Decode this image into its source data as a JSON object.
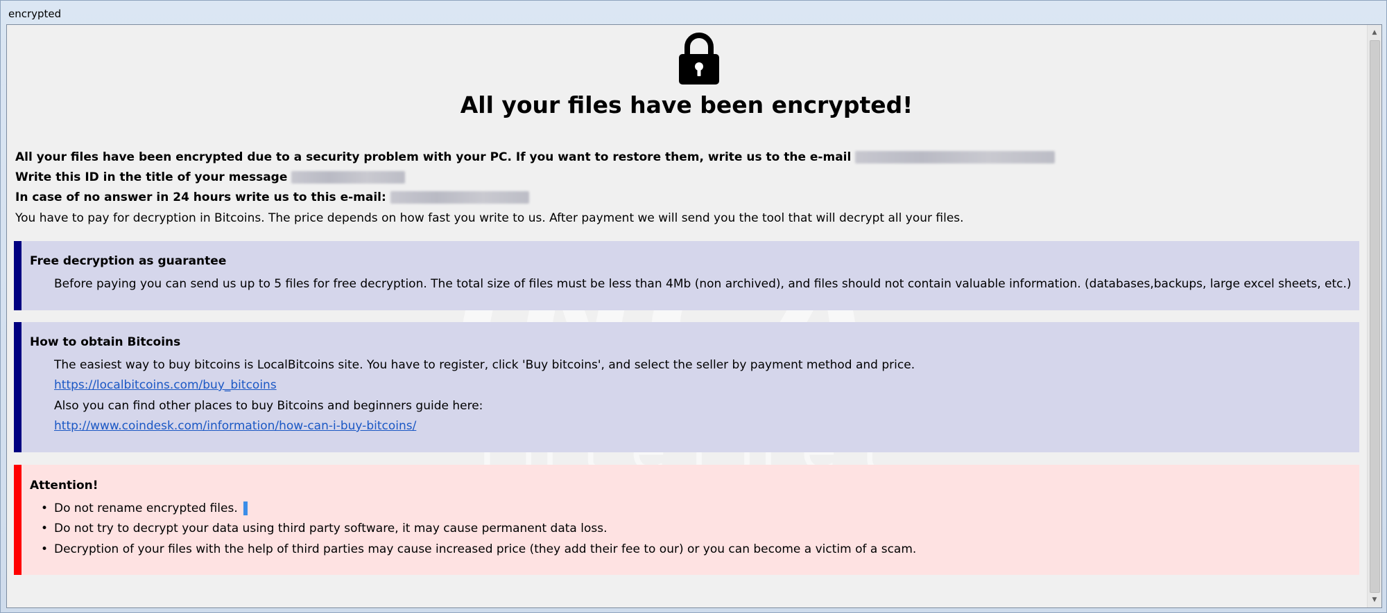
{
  "window": {
    "title": "encrypted"
  },
  "header": {
    "icon": "lock-icon",
    "headline": "All your files have been encrypted!"
  },
  "intro": {
    "line1": "All your files have been encrypted due to a security problem with your PC. If you want to restore them, write us to the e-mail",
    "line2": "Write this ID in the title of your message",
    "line3": "In case of no answer in 24 hours write us to this e-mail:",
    "line4": "You have to pay for decryption in Bitcoins. The price depends on how fast you write to us. After payment we will send you the tool that will decrypt all your files."
  },
  "guarantee": {
    "title": "Free decryption as guarantee",
    "text": "Before paying you can send us up to 5 files for free decryption. The total size of files must be less than 4Mb (non archived), and files should not contain valuable information. (databases,backups, large excel sheets, etc.)"
  },
  "bitcoins": {
    "title": "How to obtain Bitcoins",
    "text1": "The easiest way to buy bitcoins is LocalBitcoins site. You have to register, click 'Buy bitcoins', and select the seller by payment method and price.",
    "link1": "https://localbitcoins.com/buy_bitcoins",
    "text2": "Also you can find other places to buy Bitcoins and beginners guide here:",
    "link2": "http://www.coindesk.com/information/how-can-i-buy-bitcoins/"
  },
  "attention": {
    "title": "Attention!",
    "items": [
      "Do not rename encrypted files.",
      "Do not try to decrypt your data using third party software, it may cause permanent data loss.",
      "Decryption of your files with the help of third parties may cause increased price (they add their fee to our) or you can become a victim of a scam."
    ]
  },
  "watermark": {
    "big": "INCA",
    "small": "Internet"
  },
  "colors": {
    "info_accent": "#000080",
    "info_bg": "#d5d6eb",
    "alert_accent": "#ff0000",
    "alert_bg": "#fee2e2",
    "link": "#1a57c4"
  }
}
